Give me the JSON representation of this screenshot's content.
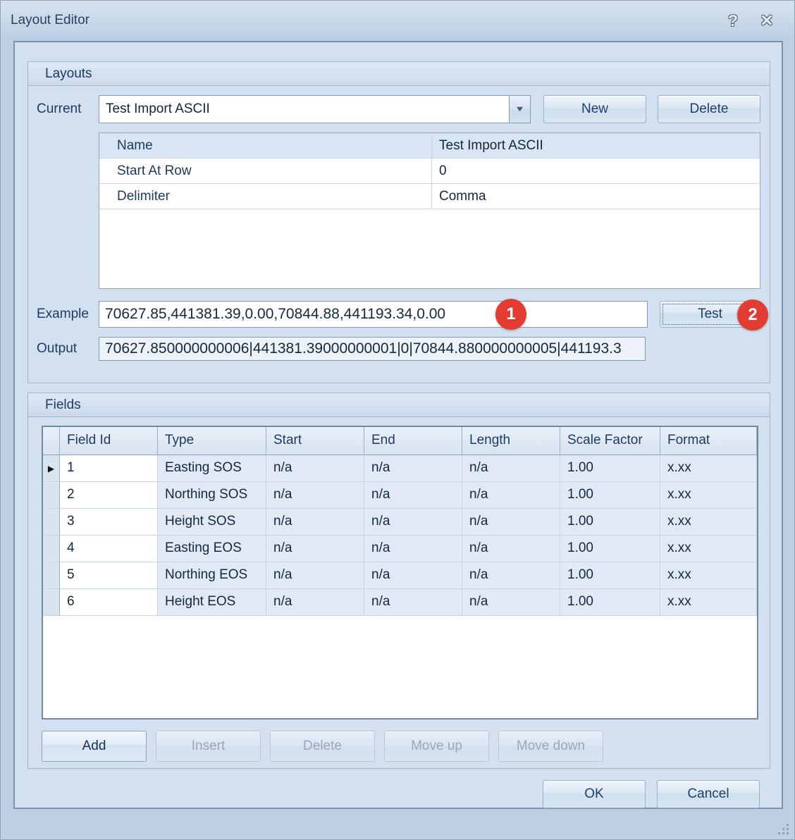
{
  "window": {
    "title": "Layout Editor"
  },
  "icons": {
    "help": "?",
    "close": "✕",
    "dropdown": "▼",
    "row_pointer": "▶"
  },
  "colors": {
    "badge": "#e23c32",
    "accent_text": "#1d3a5f"
  },
  "layouts": {
    "group_title": "Layouts",
    "current_label": "Current",
    "current_value": "Test Import ASCII",
    "new_button": "New",
    "delete_button": "Delete",
    "properties": [
      {
        "label": "Name",
        "value": "Test Import ASCII"
      },
      {
        "label": "Start At Row",
        "value": "0"
      },
      {
        "label": "Delimiter",
        "value": "Comma"
      }
    ],
    "example_label": "Example",
    "example_value": "70627.85,441381.39,0.00,70844.88,441193.34,0.00",
    "test_button": "Test",
    "output_label": "Output",
    "output_value": "70627.850000000006|441381.39000000001|0|70844.880000000005|441193.3",
    "badge_1": "1",
    "badge_2": "2"
  },
  "fields": {
    "group_title": "Fields",
    "columns": [
      "Field Id",
      "Type",
      "Start",
      "End",
      "Length",
      "Scale Factor",
      "Format"
    ],
    "rows": [
      [
        "1",
        "Easting SOS",
        "n/a",
        "n/a",
        "n/a",
        "1.00",
        "x.xx"
      ],
      [
        "2",
        "Northing SOS",
        "n/a",
        "n/a",
        "n/a",
        "1.00",
        "x.xx"
      ],
      [
        "3",
        "Height SOS",
        "n/a",
        "n/a",
        "n/a",
        "1.00",
        "x.xx"
      ],
      [
        "4",
        "Easting EOS",
        "n/a",
        "n/a",
        "n/a",
        "1.00",
        "x.xx"
      ],
      [
        "5",
        "Northing EOS",
        "n/a",
        "n/a",
        "n/a",
        "1.00",
        "x.xx"
      ],
      [
        "6",
        "Height EOS",
        "n/a",
        "n/a",
        "n/a",
        "1.00",
        "x.xx"
      ]
    ],
    "buttons": {
      "add": "Add",
      "insert": "Insert",
      "delete": "Delete",
      "move_up": "Move up",
      "move_down": "Move down"
    }
  },
  "footer": {
    "ok": "OK",
    "cancel": "Cancel"
  }
}
